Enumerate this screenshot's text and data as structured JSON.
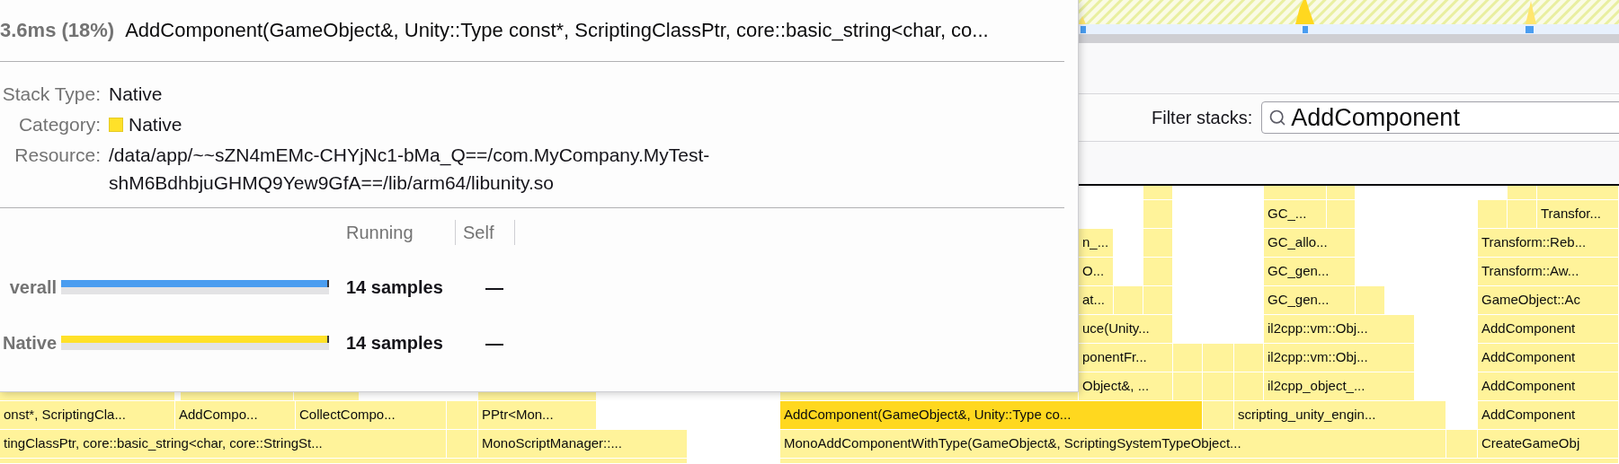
{
  "tooltip": {
    "duration": "3.6ms (18%)",
    "title": "AddComponent(GameObject&, Unity::Type const*, ScriptingClassPtr, core::basic_string<char, co...",
    "details": [
      {
        "kind": "text",
        "label": "Stack Type:",
        "value": "Native"
      },
      {
        "kind": "category",
        "label": "Category:",
        "value": "Native",
        "color": "#ffe129"
      },
      {
        "kind": "text",
        "label": "Resource:",
        "value": "/data/app/~~sZN4mEMc-CHYjNc1-bMa_Q==/com.MyCompany.MyTest-shM6BdhbjuGHMQ9Yew9GfA==/lib/arm64/libunity.so"
      }
    ],
    "columns": [
      "Running",
      "Self"
    ],
    "samples": [
      {
        "label": "verall",
        "level": 1,
        "color": "#4a9df0",
        "running": "14 samples",
        "self": "—"
      },
      {
        "label": "Native",
        "level": 1,
        "color": "#ffe129",
        "running": "14 samples",
        "self": "—"
      }
    ]
  },
  "filter": {
    "label": "Filter stacks:",
    "value": "AddComponent"
  },
  "flame_graph": {
    "frames": [
      {
        "label": "GC_...",
        "selected": false
      },
      {
        "label": "Transfor...",
        "selected": false
      },
      {
        "label": "n_...",
        "selected": false
      },
      {
        "label": "GC_allo...",
        "selected": false
      },
      {
        "label": "Transform::Reb...",
        "selected": false
      },
      {
        "label": "O...",
        "selected": false
      },
      {
        "label": "GC_gen...",
        "selected": false
      },
      {
        "label": "Transform::Aw...",
        "selected": false
      },
      {
        "label": "at...",
        "selected": false
      },
      {
        "label": "GC_gen...",
        "selected": false
      },
      {
        "label": "GameObject::Ac",
        "selected": false
      },
      {
        "label": "uce(Unity...",
        "selected": false
      },
      {
        "label": "il2cpp::vm::Obj...",
        "selected": false
      },
      {
        "label": "AddComponent",
        "selected": false
      },
      {
        "label": "ponentFr...",
        "selected": false
      },
      {
        "label": "il2cpp::vm::Obj...",
        "selected": false
      },
      {
        "label": "AddComponent",
        "selected": false
      },
      {
        "label": "Object&, ...",
        "selected": false
      },
      {
        "label": "il2cpp_object_...",
        "selected": false
      },
      {
        "label": "AddComponent",
        "selected": false
      },
      {
        "label": "onst*, ScriptingCla...",
        "selected": false
      },
      {
        "label": "AddCompo...",
        "selected": false
      },
      {
        "label": "CollectCompo...",
        "selected": false
      },
      {
        "label": "PPtr<Mon...",
        "selected": false
      },
      {
        "label": "AddComponent(GameObject&, Unity::Type co...",
        "selected": true
      },
      {
        "label": "scripting_unity_engin...",
        "selected": false
      },
      {
        "label": "AddComponent",
        "selected": false
      },
      {
        "label": "tingClassPtr, core::basic_string<char, core::StringSt...",
        "selected": false
      },
      {
        "label": "MonoScriptManager::...",
        "selected": false
      },
      {
        "label": "MonoAddComponentWithType(GameObject&, ScriptingSystemTypeObject...",
        "selected": false
      },
      {
        "label": "CreateGameObj",
        "selected": false
      }
    ]
  }
}
